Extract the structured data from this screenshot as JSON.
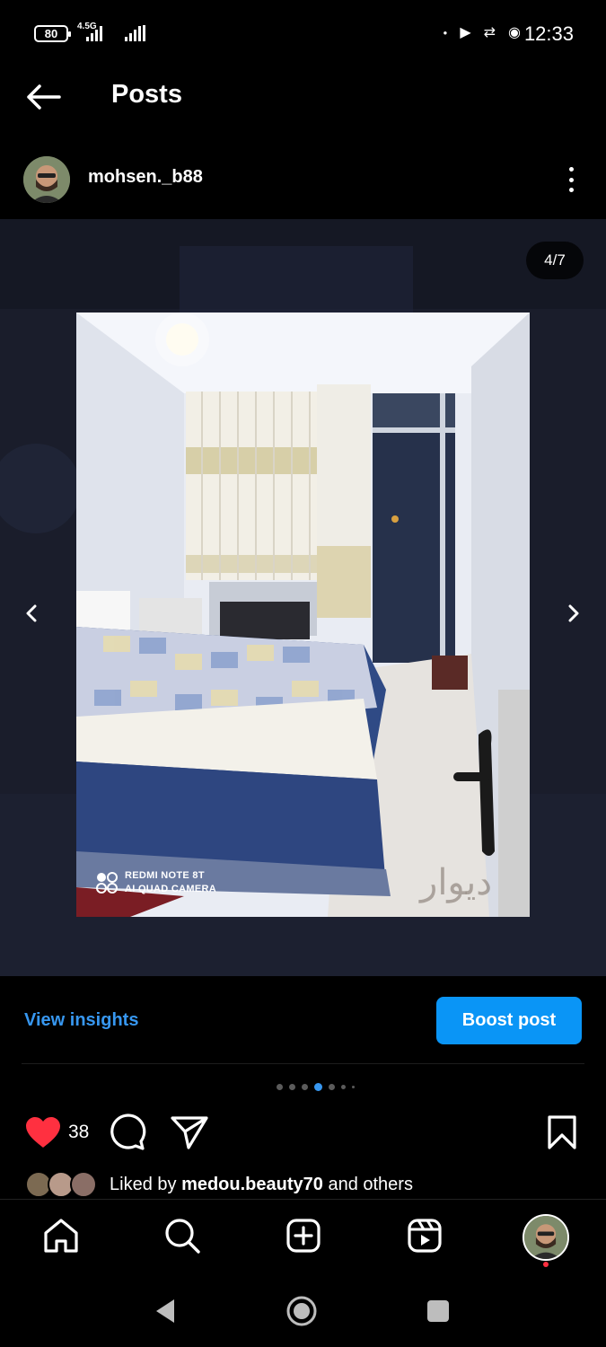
{
  "status_bar": {
    "battery": "80",
    "network": "4.5G",
    "time": "12:33"
  },
  "header": {
    "title": "Posts",
    "back_icon": "arrow-left-icon"
  },
  "post": {
    "username": "mohsen._b88",
    "slide_counter": "4/7",
    "camera_label_line1": "REDMI NOTE 8T",
    "camera_label_line2": "AI QUAD CAMERA",
    "watermark": "دیوار"
  },
  "insights": {
    "view_insights_label": "View insights",
    "boost_label": "Boost post"
  },
  "carousel": {
    "total": 7,
    "active_index": 4
  },
  "actions": {
    "like_count": "38",
    "liked_by_prefix": "Liked by ",
    "liked_by_user": "medou.beauty70",
    "liked_by_suffix": " and others"
  },
  "colors": {
    "accent": "#3797f0",
    "boost": "#0a95f6",
    "like": "#ff3040"
  },
  "bottom_nav": [
    "home-icon",
    "search-icon",
    "create-icon",
    "reels-icon",
    "profile-avatar"
  ]
}
